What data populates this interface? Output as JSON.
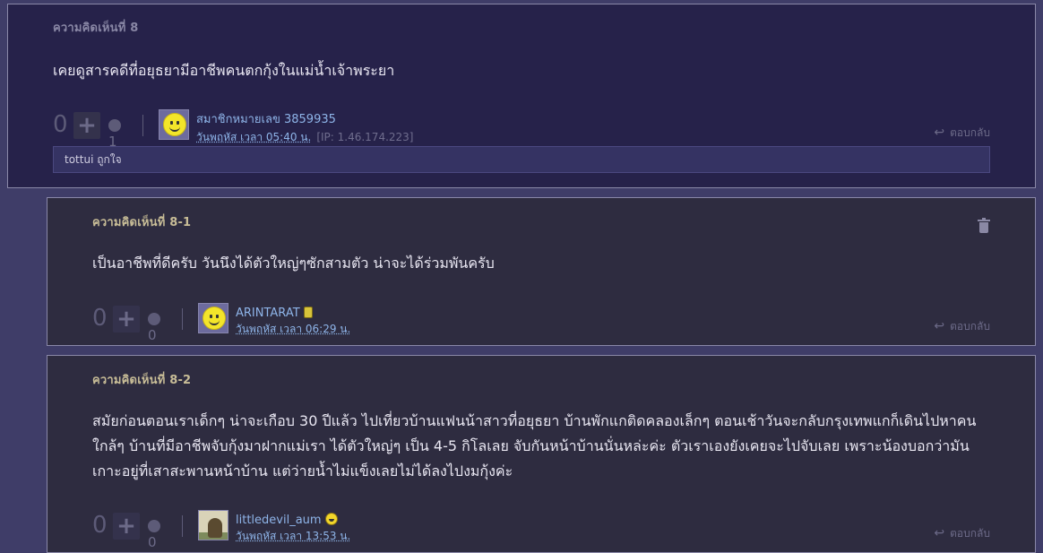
{
  "comments": [
    {
      "label": "ความคิดเห็นที่ 8",
      "text": "เคยดูสารคดีที่อยุธยามีอาชีพคนตกกุ้งในแม่น้ำเจ้าพระยา",
      "vote_count": "0",
      "plus_label": "+",
      "emotion_count": "1",
      "username": "สมาชิกหมายเลข 3859935",
      "date": "วันพฤหัส เวลา 05:40 น.",
      "ip": "[IP: 1.46.174.223]",
      "reply_label": "ตอบกลับ",
      "reaction_text": "tottui ถูกใจ",
      "avatar_icon": "smiley-avatar-icon"
    },
    {
      "label": "ความคิดเห็นที่ 8-1",
      "text": "เป็นอาชีพที่ดีครับ วันนึงได้ตัวใหญ่ๆซักสามตัว น่าจะได้ร่วมพันครับ",
      "vote_count": "0",
      "plus_label": "+",
      "emotion_count": "0",
      "username": "ARINTARAT",
      "date": "วันพฤหัส เวลา 06:29 น.",
      "reply_label": "ตอบกลับ",
      "avatar_icon": "smiley-avatar-icon",
      "badge_icon": "phone-badge-icon"
    },
    {
      "label": "ความคิดเห็นที่ 8-2",
      "text": "สมัยก่อนตอนเราเด็กๆ น่าจะเกือบ 30 ปีแล้ว ไปเที่ยวบ้านแฟนน้าสาวที่อยุธยา บ้านพักแกติดคลองเล็กๆ ตอนเช้าวันจะกลับกรุงเทพแกก็เดินไปหาคนใกล้ๆ บ้านที่มีอาชีพจับกุ้งมาฝากแม่เรา ได้ตัวใหญ่ๆ เป็น 4-5 กิโลเลย จับกันหน้าบ้านนั่นหล่ะค่ะ ตัวเราเองยังเคยจะไปจับเลย เพราะน้องบอกว่ามันเกาะอยู่ที่เสาสะพานหน้าบ้าน แต่ว่ายน้ำไม่แข็งเลยไม่ได้ลงไปงมกุ้งค่ะ",
      "vote_count": "0",
      "plus_label": "+",
      "emotion_count": "0",
      "username": "littledevil_aum",
      "date": "วันพฤหัส เวลา 13:53 น.",
      "reply_label": "ตอบกลับ",
      "avatar_icon": "photo-avatar-icon",
      "badge_icon": "laugh-badge-icon"
    }
  ]
}
